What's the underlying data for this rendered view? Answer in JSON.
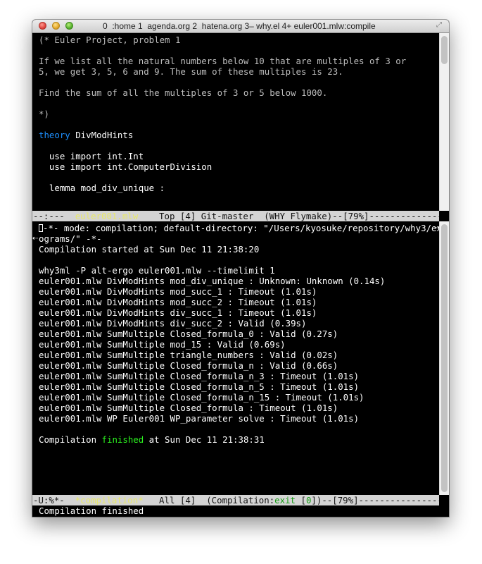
{
  "window": {
    "title": "0  :home 1  agenda.org 2  hatena.org 3– why.el 4+ euler001.mlw:compile"
  },
  "upper_buffer": {
    "lines": [
      "(* Euler Project, problem 1",
      "",
      "If we list all the natural numbers below 10 that are multiples of 3 or",
      "5, we get 3, 5, 6 and 9. The sum of these multiples is 23.",
      "",
      "Find the sum of all the multiples of 3 or 5 below 1000.",
      "",
      "*)",
      "",
      "",
      "",
      "  use import int.Int",
      "  use import int.ComputerDivision",
      "",
      "  lemma mod_div_unique :"
    ],
    "theory_keyword": "theory",
    "theory_name": " DivModHints"
  },
  "upper_modeline": {
    "prefix": "--:---  ",
    "buffer_name": "euler001.mlw",
    "suffix": "    Top [4] Git-master  (WHY Flymake)--[79%]-------------------------------"
  },
  "lower_buffer": {
    "header_line1": "-*- mode: compilation; default-directory: \"/Users/kyosuke/repository/why3/examples/pr",
    "header_line2": "ograms/\" -*-",
    "lines": [
      "Compilation started at Sun Dec 11 21:38:20",
      "",
      "why3ml -P alt-ergo euler001.mlw --timelimit 1",
      "euler001.mlw DivModHints mod_div_unique : Unknown: Unknown (0.14s)",
      "euler001.mlw DivModHints mod_succ_1 : Timeout (1.01s)",
      "euler001.mlw DivModHints mod_succ_2 : Timeout (1.01s)",
      "euler001.mlw DivModHints div_succ_1 : Timeout (1.01s)",
      "euler001.mlw DivModHints div_succ_2 : Valid (0.39s)",
      "euler001.mlw SumMultiple Closed_formula_0 : Valid (0.27s)",
      "euler001.mlw SumMultiple mod_15 : Valid (0.69s)",
      "euler001.mlw SumMultiple triangle_numbers : Valid (0.02s)",
      "euler001.mlw SumMultiple Closed_formula_n : Valid (0.66s)",
      "euler001.mlw SumMultiple Closed_formula_n_3 : Timeout (1.01s)",
      "euler001.mlw SumMultiple Closed_formula_n_5 : Timeout (1.01s)",
      "euler001.mlw SumMultiple Closed_formula_n_15 : Timeout (1.01s)",
      "euler001.mlw SumMultiple Closed_formula : Timeout (1.01s)",
      "euler001.mlw WP Euler001 WP_parameter solve : Timeout (1.01s)"
    ],
    "finish_prefix": "Compilation ",
    "finish_word": "finished",
    "finish_suffix": " at Sun Dec 11 21:38:31"
  },
  "lower_modeline": {
    "prefix": "-U:%*-  ",
    "buffer_name": "*compilation*",
    "middle": "   All [4]  (Compilation:",
    "exit_word": "exit",
    "exit_code_open": " [",
    "exit_code": "0",
    "exit_code_close": "]",
    "suffix": ")--[79%]-------------------------------------"
  },
  "echo_area": {
    "text": "Compilation finished"
  },
  "colors": {
    "keyword": "#1e90ff",
    "finished": "#2cf51f",
    "modeline_bg": "#d4d4d4",
    "background": "#000000"
  },
  "icons": {
    "close": "close-traffic-light",
    "minimize": "minimize-traffic-light",
    "zoom": "zoom-traffic-light",
    "fullscreen": "fullscreen-resize-icon",
    "fringe_left": "left-arrow-icon",
    "fringe_right": "right-arrow-icon"
  }
}
